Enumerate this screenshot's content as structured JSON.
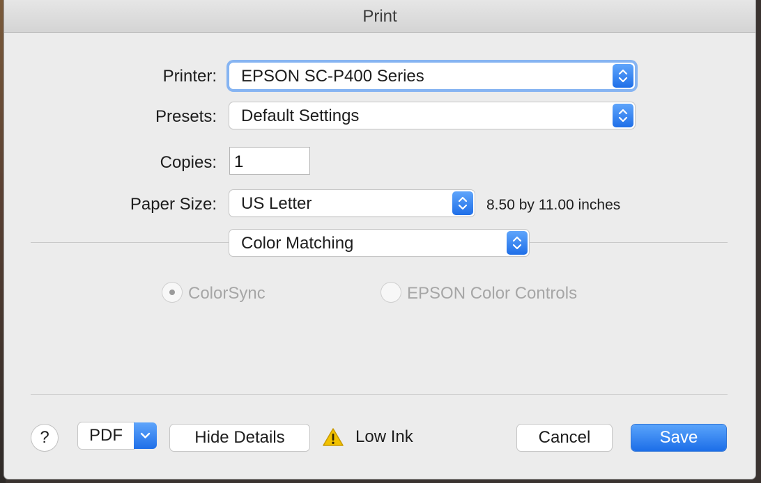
{
  "window": {
    "title": "Print"
  },
  "printer": {
    "label": "Printer:",
    "value": "EPSON SC-P400 Series"
  },
  "presets": {
    "label": "Presets:",
    "value": "Default Settings"
  },
  "copies": {
    "label": "Copies:",
    "value": "1"
  },
  "paper_size": {
    "label": "Paper Size:",
    "value": "US Letter",
    "dimensions": "8.50 by 11.00 inches"
  },
  "panel": {
    "value": "Color Matching"
  },
  "color_options": [
    {
      "label": "ColorSync",
      "selected": true,
      "enabled": false
    },
    {
      "label": "EPSON Color Controls",
      "selected": false,
      "enabled": false
    }
  ],
  "footer": {
    "help_label": "?",
    "pdf_label": "PDF",
    "hide_details_label": "Hide Details",
    "status_text": "Low Ink",
    "cancel_label": "Cancel",
    "save_label": "Save"
  },
  "icons": {
    "warning": "warning-triangle-icon",
    "stepper": "up-down-chevron-icon"
  },
  "colors": {
    "accent": "#1f6fe8",
    "focus_ring": "#86b4f2",
    "warning": "#f2c200"
  }
}
